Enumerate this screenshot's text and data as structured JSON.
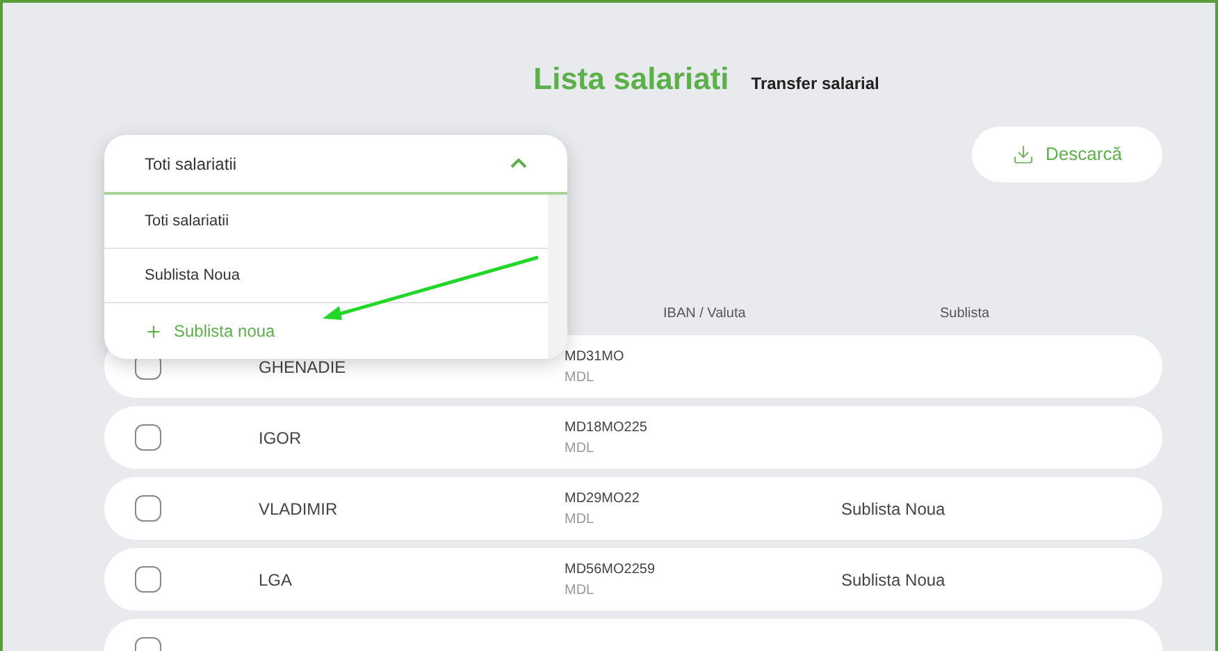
{
  "header": {
    "title": "Lista salariati",
    "link": "Transfer salarial"
  },
  "filter": {
    "value": "Toti salariatii",
    "expanded": true,
    "options": [
      {
        "label": "Toti salariatii",
        "kind": "option"
      },
      {
        "label": "Sublista Noua",
        "kind": "option"
      },
      {
        "label": "Sublista noua",
        "kind": "add"
      }
    ]
  },
  "download_button": {
    "label": "Descarcă"
  },
  "table": {
    "columns": [
      "IBAN / Valuta",
      "Sublista"
    ],
    "rows": [
      {
        "checked": false,
        "name": "GHENADIE",
        "iban": "MD31MO",
        "currency": "MDL",
        "sublist": ""
      },
      {
        "checked": false,
        "name": "IGOR",
        "iban": "MD18MO225",
        "currency": "MDL",
        "sublist": ""
      },
      {
        "checked": false,
        "name": "VLADIMIR",
        "iban": "MD29MO22",
        "currency": "MDL",
        "sublist": "Sublista Noua"
      },
      {
        "checked": false,
        "name": "LGA",
        "iban": "MD56MO2259",
        "currency": "MDL",
        "sublist": "Sublista Noua"
      },
      {
        "checked": false
      }
    ]
  }
}
